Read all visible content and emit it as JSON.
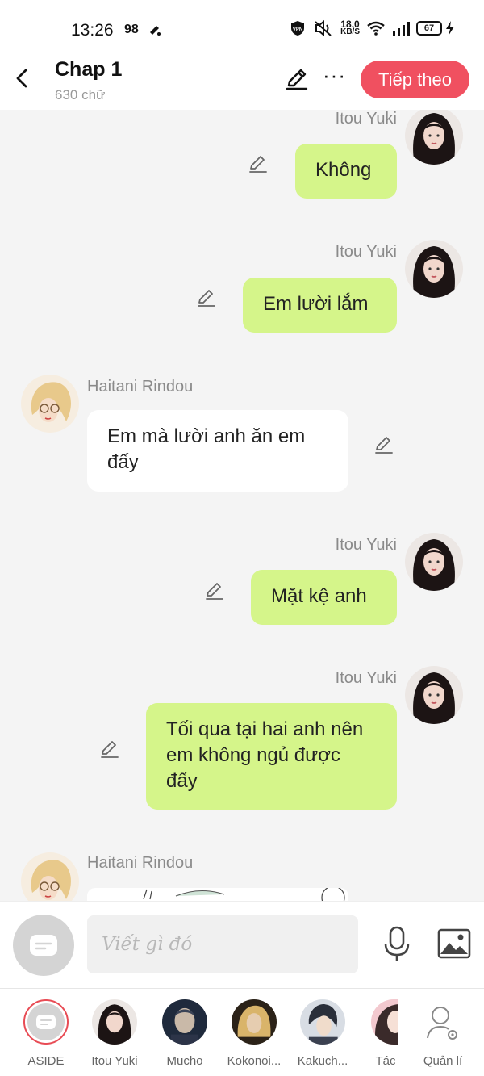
{
  "status_bar": {
    "time": "13:26",
    "notification_count": "98",
    "net_speed_value": "18.0",
    "net_speed_unit": "KB/S",
    "battery": "67"
  },
  "header": {
    "title": "Chap 1",
    "subtitle": "630 chữ",
    "next_label": "Tiếp theo",
    "accent_color": "#f05060"
  },
  "messages": [
    {
      "sender": "Itou Yuki",
      "text": "Không",
      "side": "right"
    },
    {
      "sender": "Itou Yuki",
      "text": "Em lười lắm",
      "side": "right"
    },
    {
      "sender": "Haitani Rindou",
      "text": "Em mà lười anh ăn em đấy",
      "side": "left"
    },
    {
      "sender": "Itou Yuki",
      "text": "Mặt kệ anh",
      "side": "right"
    },
    {
      "sender": "Itou Yuki",
      "text": "Tối qua tại hai anh nên em không ngủ được đấy",
      "side": "right"
    },
    {
      "sender": "Haitani Rindou",
      "text": "",
      "side": "left"
    }
  ],
  "bubble_colors": {
    "me": "#d5f58a",
    "other": "#ffffff"
  },
  "input": {
    "placeholder": "Viết gì đó"
  },
  "characters": [
    {
      "label": "ASIDE"
    },
    {
      "label": "Itou Yuki"
    },
    {
      "label": "Mucho"
    },
    {
      "label": "Kokonoi..."
    },
    {
      "label": "Kakuch..."
    },
    {
      "label": "Tác"
    },
    {
      "label": "Quản lí"
    }
  ]
}
